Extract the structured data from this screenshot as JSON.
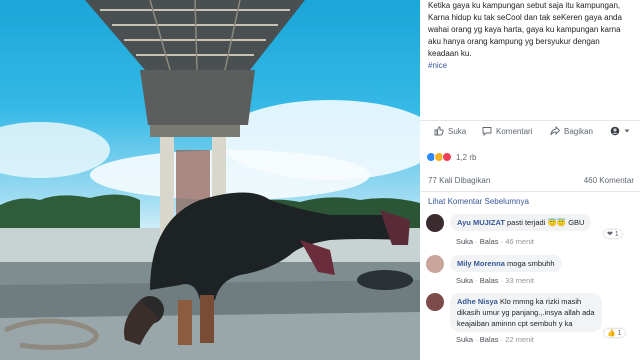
{
  "post": {
    "caption_lines": [
      "Ketika gaya ku kampungan sebut saja itu kampungan,",
      "Karna hidup ku tak seCool dan tak seKeren gaya anda",
      "wahai orang yg kaya harta, gaya ku kampungan karna",
      "aku hanya orang kampung yg bersyukur dengan",
      "keadaan ku."
    ],
    "hashtag": "#nice"
  },
  "actions": {
    "like": "Suka",
    "comment": "Komentari",
    "share": "Bagikan"
  },
  "reactions": {
    "count": "1,2 rb",
    "colors": [
      "#2d88ff",
      "#f7b125",
      "#f33e58"
    ]
  },
  "stats": {
    "shares": "77 Kali Dibagikan",
    "comments": "460 Komentar"
  },
  "previous_comments_label": "Lihat Komentar Sebelumnya",
  "comments": [
    {
      "author": "Ayu MUJIZAT",
      "text": "pasti terjadi 😇😇 GBU",
      "like": "Suka",
      "reply": "Balas",
      "time": "46 menit",
      "badge": "❤ 1"
    },
    {
      "author": "Mily Morenna",
      "text": "moga smbuhh",
      "like": "Suka",
      "reply": "Balas",
      "time": "33 menit",
      "badge": ""
    },
    {
      "author": "Adhe Nisya",
      "text_lines": [
        "Klo mmng ka rizki masih",
        "dikasih umur yg panjang.,.insya allah ada",
        "keajaiban aminnn cpt sembuh y ka"
      ],
      "like": "Suka",
      "reply": "Balas",
      "time": "22 menit",
      "badge": "👍 1"
    }
  ]
}
